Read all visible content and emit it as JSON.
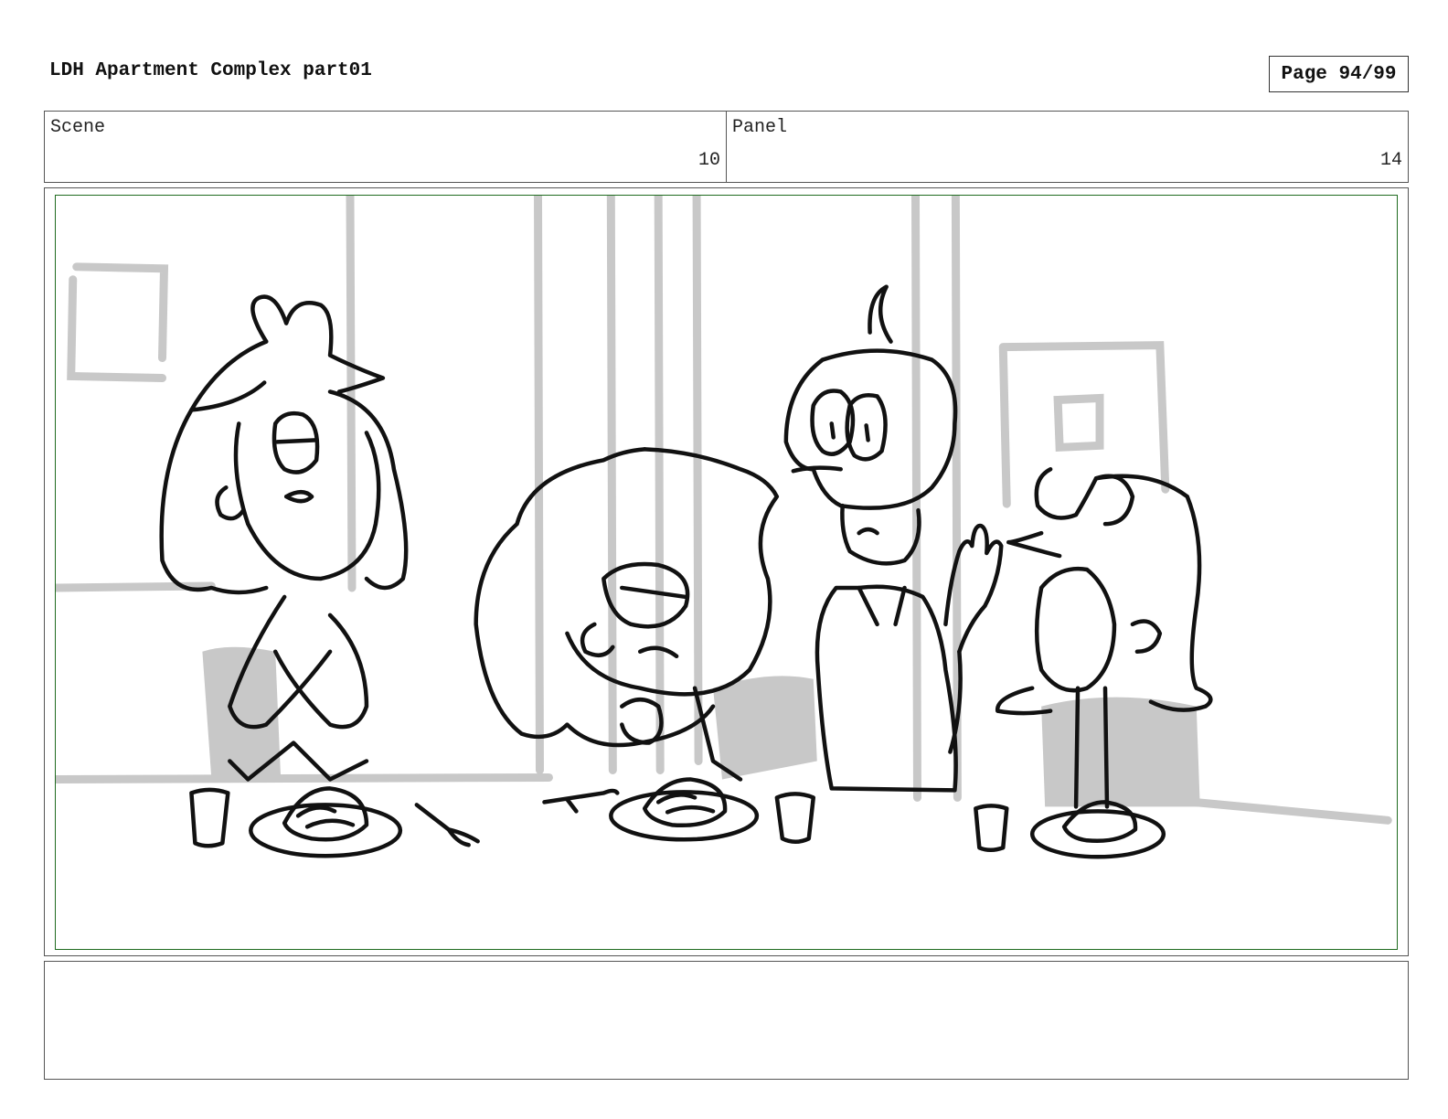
{
  "header": {
    "title": "LDH Apartment Complex part01",
    "page_label": "Page 94/99"
  },
  "info": {
    "scene_label": "Scene",
    "scene_value": "10",
    "panel_label": "Panel",
    "panel_value": "14"
  },
  "panel": {
    "frame_color": "#1f6b1f",
    "background_line_color": "#c8c8c8",
    "ink_color": "#111111"
  },
  "notes": {
    "text": ""
  }
}
